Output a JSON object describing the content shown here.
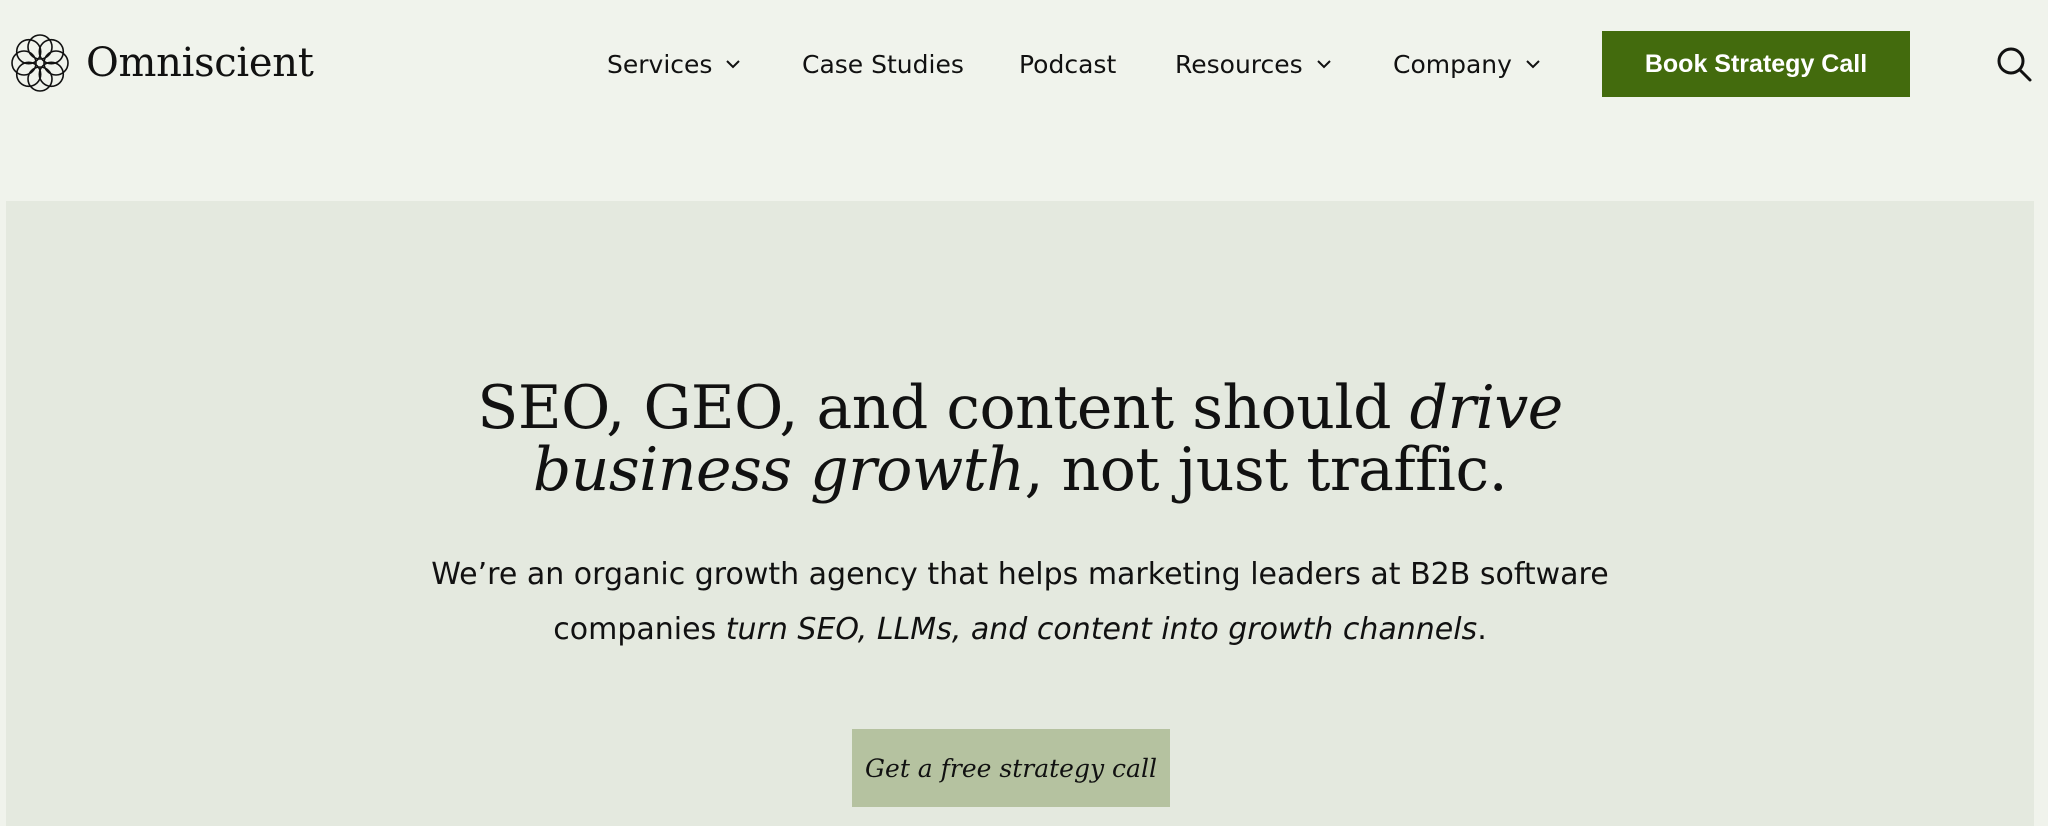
{
  "brand": {
    "name": "Omniscient",
    "logo_icon": "interlaced-circles-logo-icon"
  },
  "nav": {
    "items": [
      {
        "label": "Services",
        "has_dropdown": true
      },
      {
        "label": "Case Studies",
        "has_dropdown": false
      },
      {
        "label": "Podcast",
        "has_dropdown": false
      },
      {
        "label": "Resources",
        "has_dropdown": true
      },
      {
        "label": "Company",
        "has_dropdown": true
      }
    ],
    "cta_label": "Book Strategy Call",
    "search_icon": "search-icon"
  },
  "hero": {
    "headline_part1": "SEO, GEO, and content should ",
    "headline_em1": "drive",
    "headline_em2": "business growth",
    "headline_part2": ", not just traffic.",
    "sub_line1": "We’re an organic growth agency that helps marketing leaders at B2B software",
    "sub_line2_pre": "companies ",
    "sub_line2_em": "turn SEO, LLMs, and content into growth channels",
    "sub_line2_post": ".",
    "cta_label": "Get a free strategy call"
  },
  "colors": {
    "page_bg": "#f0f3ec",
    "hero_bg": "#e4e9df",
    "primary_cta": "#436b0d",
    "secondary_cta": "#b5c2a0",
    "text": "#111111"
  }
}
